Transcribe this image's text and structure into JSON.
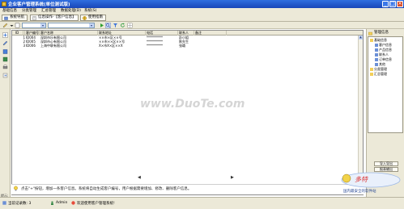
{
  "window": {
    "title": "企业客户管理系统(单位测试版)",
    "controls": [
      "_",
      "□",
      "×"
    ]
  },
  "menu": [
    "基础信息",
    "分类管理",
    "汇总管理",
    "数据处理(D)",
    "系统(S)"
  ],
  "tabs": [
    {
      "label": "系统导航",
      "icon": "home-icon"
    },
    {
      "label": "信息操作-【客户信息】",
      "icon": "document-icon",
      "active": true
    },
    {
      "label": "使用指南",
      "icon": "help-icon"
    }
  ],
  "grid": {
    "columns": [
      "ID",
      "客户编号",
      "客户名称",
      "联系地址",
      "电话",
      "联系人",
      "备注"
    ],
    "rows": [
      {
        "num": "1",
        "id": "ID004",
        "code": "深圳市乐有限公司",
        "name": "××市×区××号",
        "phone": "**********",
        "contact": "彭小姐",
        "note": ""
      },
      {
        "num": "2",
        "id": "ID005",
        "code": "深圳市心有限公司",
        "name": "××市××区××号",
        "phone": "**********",
        "contact": "陈先生",
        "note": ""
      },
      {
        "num": "3",
        "id": "ID006",
        "code": "上海中联有限公司",
        "name": "X×市X×区××X",
        "phone": "**********",
        "contact": "张璐",
        "note": ""
      }
    ],
    "watermark": "www.DuoTe.com"
  },
  "tip": "点击\"+\"按钮，增加一条客户信息。系统将自动生成客户编号，用户根据需要增加、修改、删除客户信息。",
  "hint": "提示:",
  "pager": [
    "◀",
    "▶"
  ],
  "nav_tree": {
    "header": "管理信息",
    "nodes": [
      "基础信息",
      "客户信息",
      "产品信息",
      "联系人",
      "订单信息",
      "其他",
      "分类管理",
      "汇总管理"
    ]
  },
  "right_buttons": [
    "导入导出",
    "报表输出"
  ],
  "logo_text": "国内最安全的软件站",
  "statusbar": {
    "records": "当前记录数: 3",
    "user": "Admin",
    "welcome": "欢迎使用客户管理系统!"
  },
  "colors": {
    "titlebar": "#1846b8",
    "chrome": "#ece9d8",
    "grid_border": "#8a8a8a"
  }
}
